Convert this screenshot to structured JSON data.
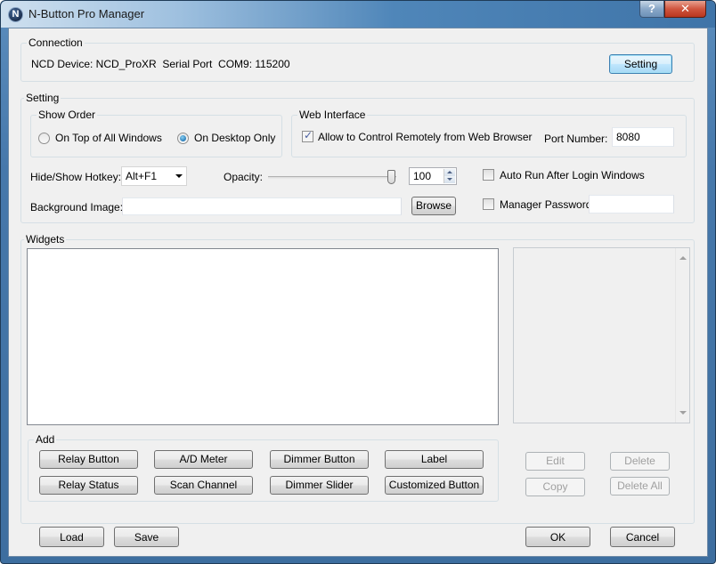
{
  "window": {
    "title": "N-Button Pro Manager",
    "icon_glyph": "N",
    "help_glyph": "?",
    "close_glyph": "✕"
  },
  "connection": {
    "group_label": "Connection",
    "status_text": "NCD Device: NCD_ProXR  Serial Port  COM9: 115200",
    "setting_button": "Setting"
  },
  "setting": {
    "group_label": "Setting",
    "show_order": {
      "group_label": "Show Order",
      "options": [
        {
          "label": "On Top of All Windows",
          "checked": false
        },
        {
          "label": "On Desktop Only",
          "checked": true
        }
      ]
    },
    "web_interface": {
      "group_label": "Web Interface",
      "allow_remote_label": "Allow to Control Remotely from Web Browser",
      "allow_remote_checked": true,
      "port_label": "Port Number:",
      "port_value": "8080"
    },
    "hotkey_label": "Hide/Show Hotkey:",
    "hotkey_value": "Alt+F1",
    "opacity_label": "Opacity:",
    "opacity_value": "100",
    "opacity_percent": 100,
    "auto_run_label": "Auto Run After Login Windows",
    "auto_run_checked": false,
    "background_label": "Background Image:",
    "background_value": "",
    "browse_button": "Browse",
    "password_label": "Manager Password",
    "password_checked": false,
    "password_value": ""
  },
  "widgets": {
    "group_label": "Widgets",
    "add": {
      "group_label": "Add",
      "buttons": [
        "Relay Button",
        "A/D Meter",
        "Dimmer Button",
        "Label",
        "Relay Status",
        "Scan Channel",
        "Dimmer Slider",
        "Customized Button"
      ]
    },
    "edit_button": "Edit",
    "delete_button": "Delete",
    "copy_button": "Copy",
    "delete_all_button": "Delete All"
  },
  "footer": {
    "load_button": "Load",
    "save_button": "Save",
    "ok_button": "OK",
    "cancel_button": "Cancel"
  }
}
